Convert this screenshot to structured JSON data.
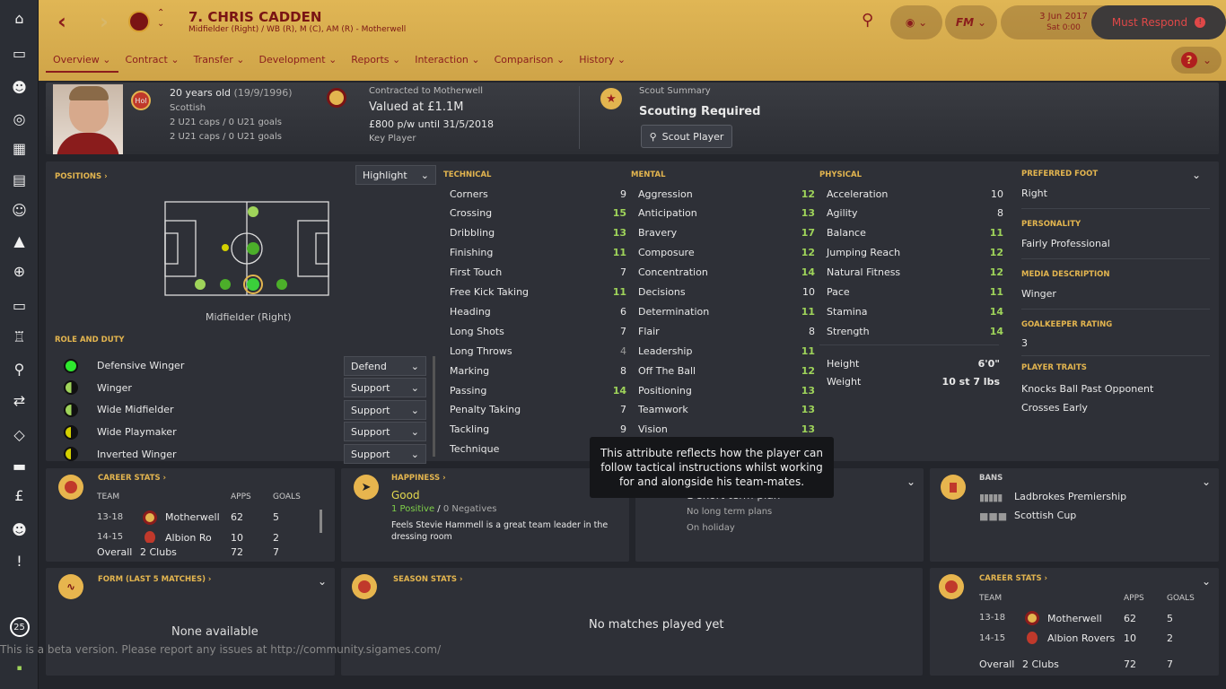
{
  "sidebar": {
    "icons": [
      "home-icon",
      "inbox-icon",
      "squad-icon",
      "dynamics-icon",
      "tactics-icon",
      "team-report-icon",
      "staff-icon",
      "training-icon",
      "medical-icon",
      "schedule-icon",
      "competitions-icon",
      "scouting-icon",
      "transfers-icon",
      "club-vision-icon",
      "finances-icon",
      "dev-centre-icon",
      "report-issue-icon"
    ],
    "bottom_badge": "25"
  },
  "header": {
    "title": "7. CHRIS CADDEN",
    "subtitle": "Midfielder (Right) / WB (R), M (C), AM (R) - Motherwell",
    "date": "3 Jun 2017",
    "time": "Sat 0:00",
    "must_respond": "Must Respond",
    "fm_label": "FM",
    "tabs": [
      "Overview",
      "Contract",
      "Transfer",
      "Development",
      "Reports",
      "Interaction",
      "Comparison",
      "History"
    ]
  },
  "profile": {
    "badge": "Hol",
    "age": "20 years old",
    "dob": "(19/9/1996)",
    "nationality": "Scottish",
    "caps1": "2 U21 caps / 0 U21 goals",
    "caps2": "2 U21 caps / 0 U21 goals",
    "contract_label": "Contracted to Motherwell",
    "value": "Valued at £1.1M",
    "wage": "£800 p/w until 31/5/2018",
    "status": "Key Player",
    "scout_label": "Scout Summary",
    "scout_status": "Scouting Required",
    "scout_button": "Scout Player"
  },
  "positions": {
    "label": "POSITIONS",
    "highlight": "Highlight",
    "pos_name": "Midfielder (Right)",
    "role_label": "ROLE AND DUTY",
    "roles": [
      {
        "name": "Defensive Winger",
        "duty": "Defend"
      },
      {
        "name": "Winger",
        "duty": "Support"
      },
      {
        "name": "Wide Midfielder",
        "duty": "Support"
      },
      {
        "name": "Wide Playmaker",
        "duty": "Support"
      },
      {
        "name": "Inverted Winger",
        "duty": "Support"
      }
    ]
  },
  "attributes": {
    "technical_label": "TECHNICAL",
    "mental_label": "MENTAL",
    "physical_label": "PHYSICAL",
    "technical": [
      [
        "Corners",
        "9"
      ],
      [
        "Crossing",
        "15"
      ],
      [
        "Dribbling",
        "13"
      ],
      [
        "Finishing",
        "11"
      ],
      [
        "First Touch",
        "7"
      ],
      [
        "Free Kick Taking",
        "11"
      ],
      [
        "Heading",
        "6"
      ],
      [
        "Long Shots",
        "7"
      ],
      [
        "Long Throws",
        "4"
      ],
      [
        "Marking",
        "8"
      ],
      [
        "Passing",
        "14"
      ],
      [
        "Penalty Taking",
        "7"
      ],
      [
        "Tackling",
        "9"
      ],
      [
        "Technique",
        ""
      ]
    ],
    "mental": [
      [
        "Aggression",
        "12"
      ],
      [
        "Anticipation",
        "13"
      ],
      [
        "Bravery",
        "17"
      ],
      [
        "Composure",
        "12"
      ],
      [
        "Concentration",
        "14"
      ],
      [
        "Decisions",
        "10"
      ],
      [
        "Determination",
        "11"
      ],
      [
        "Flair",
        "8"
      ],
      [
        "Leadership",
        "11"
      ],
      [
        "Off The Ball",
        "12"
      ],
      [
        "Positioning",
        "13"
      ],
      [
        "Teamwork",
        "13"
      ],
      [
        "Vision",
        "13"
      ]
    ],
    "physical": [
      [
        "Acceleration",
        "10"
      ],
      [
        "Agility",
        "8"
      ],
      [
        "Balance",
        "11"
      ],
      [
        "Jumping Reach",
        "12"
      ],
      [
        "Natural Fitness",
        "12"
      ],
      [
        "Pace",
        "11"
      ],
      [
        "Stamina",
        "14"
      ],
      [
        "Strength",
        "14"
      ]
    ],
    "height_label": "Height",
    "height": "6'0\"",
    "weight_label": "Weight",
    "weight": "10 st 7 lbs"
  },
  "info": {
    "foot_label": "PREFERRED FOOT",
    "foot": "Right",
    "personality_label": "PERSONALITY",
    "personality": "Fairly Professional",
    "media_label": "MEDIA DESCRIPTION",
    "media": "Winger",
    "gk_label": "GOALKEEPER RATING",
    "gk": "3",
    "traits_label": "PLAYER TRAITS",
    "traits": [
      "Knocks Ball Past Opponent",
      "Crosses Early"
    ]
  },
  "tooltip": "This attribute reflects how the player can follow tactical instructions whilst working for and alongside his team-mates.",
  "career": {
    "label": "CAREER STATS",
    "cols": [
      "TEAM",
      "APPS",
      "GOALS"
    ],
    "rows": [
      [
        "13-18",
        "Motherwell",
        "62",
        "5"
      ],
      [
        "14-15",
        "Albion Ro",
        "10",
        "2"
      ]
    ],
    "overall": [
      "Overall",
      "2 Clubs",
      "72",
      "7"
    ]
  },
  "happiness": {
    "label": "HAPPINESS",
    "status": "Good",
    "positive": "1 Positive",
    "sep": "/",
    "negative": "0 Negatives",
    "note": "Feels Stevie Hammell is a great team leader in the dressing room"
  },
  "plans": {
    "short": "1 short term plan",
    "long": "No long term plans",
    "holiday": "On holiday"
  },
  "bans": {
    "label": "BANS",
    "items": [
      "Ladbrokes Premiership",
      "Scottish Cup"
    ]
  },
  "form": {
    "label": "FORM (LAST 5 MATCHES)",
    "empty": "None available"
  },
  "season": {
    "label": "SEASON STATS",
    "empty": "No matches played yet"
  },
  "career2": {
    "label": "CAREER STATS",
    "cols": [
      "TEAM",
      "APPS",
      "GOALS"
    ],
    "rows": [
      [
        "13-18",
        "Motherwell",
        "62",
        "5"
      ],
      [
        "14-15",
        "Albion Rovers",
        "10",
        "2"
      ]
    ],
    "overall": [
      "Overall",
      "2 Clubs",
      "72",
      "7"
    ]
  },
  "beta": "This is a beta version. Please report any issues at http://community.sigames.com/"
}
